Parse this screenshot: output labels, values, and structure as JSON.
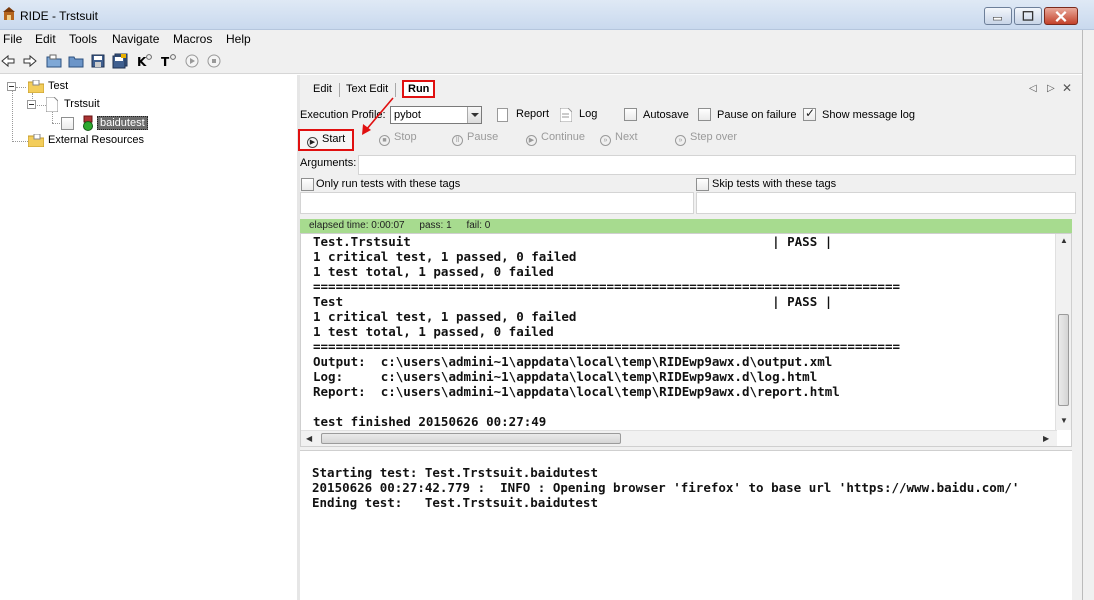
{
  "window": {
    "title": "RIDE - Trstsuit"
  },
  "menu": [
    "File",
    "Edit",
    "Tools",
    "Navigate",
    "Macros",
    "Help"
  ],
  "tree": {
    "root": "Test",
    "suite": "Trstsuit",
    "testcase": "baidutest",
    "resources": "External Resources"
  },
  "tabs": {
    "edit": "Edit",
    "text_edit": "Text Edit",
    "run": "Run"
  },
  "run": {
    "profile_label": "Execution Profile:",
    "profile_value": "pybot",
    "report_label": "Report",
    "log_label": "Log",
    "autosave_label": "Autosave",
    "pause_on_failure_label": "Pause on failure",
    "show_message_log_label": "Show message log",
    "buttons": {
      "start": "Start",
      "stop": "Stop",
      "pause": "Pause",
      "continue": "Continue",
      "next": "Next",
      "step_over": "Step over"
    },
    "arguments_label": "Arguments:",
    "only_run_tags_label": "Only run tests with these tags",
    "skip_tags_label": "Skip tests with these tags",
    "status": {
      "elapsed": "elapsed time: 0:00:07",
      "pass": "pass: 1",
      "fail": "fail: 0"
    },
    "color_pass": "#a7db8f",
    "output_lines": [
      "Test.Trstsuit                                                | PASS |",
      "1 critical test, 1 passed, 0 failed",
      "1 test total, 1 passed, 0 failed",
      "==============================================================================",
      "Test                                                         | PASS |",
      "1 critical test, 1 passed, 0 failed",
      "1 test total, 1 passed, 0 failed",
      "==============================================================================",
      "Output:  c:\\users\\admini~1\\appdata\\local\\temp\\RIDEwp9awx.d\\output.xml",
      "Log:     c:\\users\\admini~1\\appdata\\local\\temp\\RIDEwp9awx.d\\log.html",
      "Report:  c:\\users\\admini~1\\appdata\\local\\temp\\RIDEwp9awx.d\\report.html",
      "",
      "test finished 20150626 00:27:49"
    ],
    "message_log_lines": [
      "Starting test: Test.Trstsuit.baidutest",
      "20150626 00:27:42.779 :  INFO : Opening browser 'firefox' to base url 'https://www.baidu.com/'",
      "Ending test:   Test.Trstsuit.baidutest"
    ]
  }
}
